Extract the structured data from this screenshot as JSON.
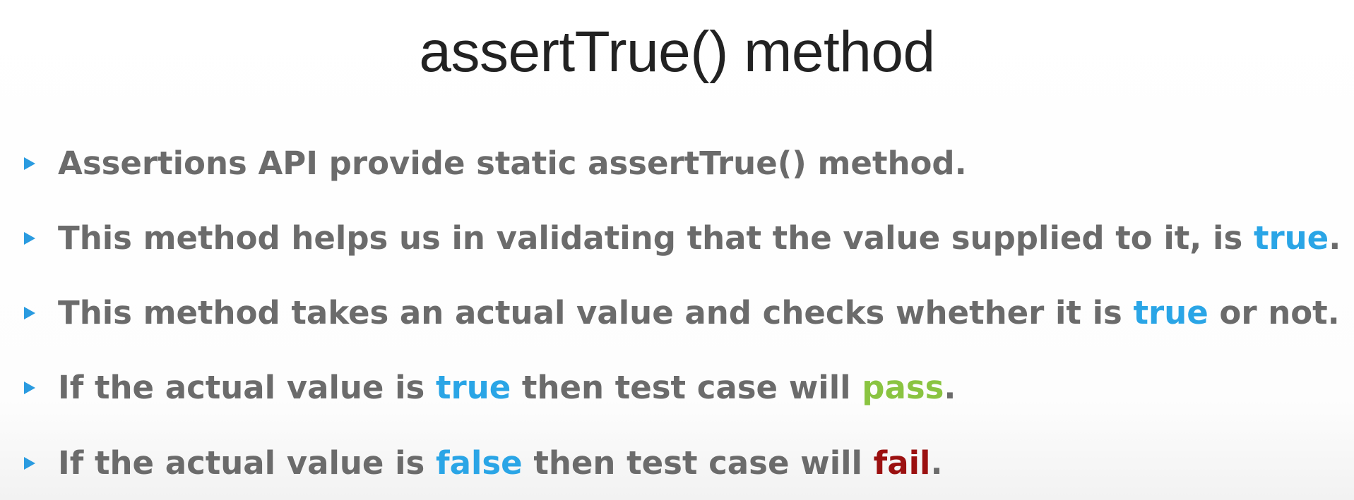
{
  "title": "assertTrue() method",
  "colors": {
    "bullet_marker": "#2a9be0",
    "body_text": "#6b6b6b",
    "keyword_true_false": "#2aa5e6",
    "keyword_pass": "#8ac441",
    "keyword_fail": "#9b1010"
  },
  "bullets": [
    {
      "segments": [
        {
          "text": "Assertions API provide static assertTrue() method.",
          "style": "normal"
        }
      ]
    },
    {
      "segments": [
        {
          "text": "This method helps us in validating that the value supplied to it, is ",
          "style": "normal"
        },
        {
          "text": "true",
          "style": "blue"
        },
        {
          "text": ".",
          "style": "normal"
        }
      ]
    },
    {
      "segments": [
        {
          "text": "This method takes an actual value and checks whether it is ",
          "style": "normal"
        },
        {
          "text": "true",
          "style": "blue"
        },
        {
          "text": " or not.",
          "style": "normal"
        }
      ]
    },
    {
      "segments": [
        {
          "text": "If the actual value is ",
          "style": "normal"
        },
        {
          "text": "true",
          "style": "blue"
        },
        {
          "text": " then test case will ",
          "style": "normal"
        },
        {
          "text": "pass",
          "style": "green"
        },
        {
          "text": ".",
          "style": "normal"
        }
      ]
    },
    {
      "segments": [
        {
          "text": "If the actual value is ",
          "style": "normal"
        },
        {
          "text": "false",
          "style": "blue"
        },
        {
          "text": " then test case will ",
          "style": "normal"
        },
        {
          "text": "fail",
          "style": "red"
        },
        {
          "text": ".",
          "style": "normal"
        }
      ]
    }
  ]
}
